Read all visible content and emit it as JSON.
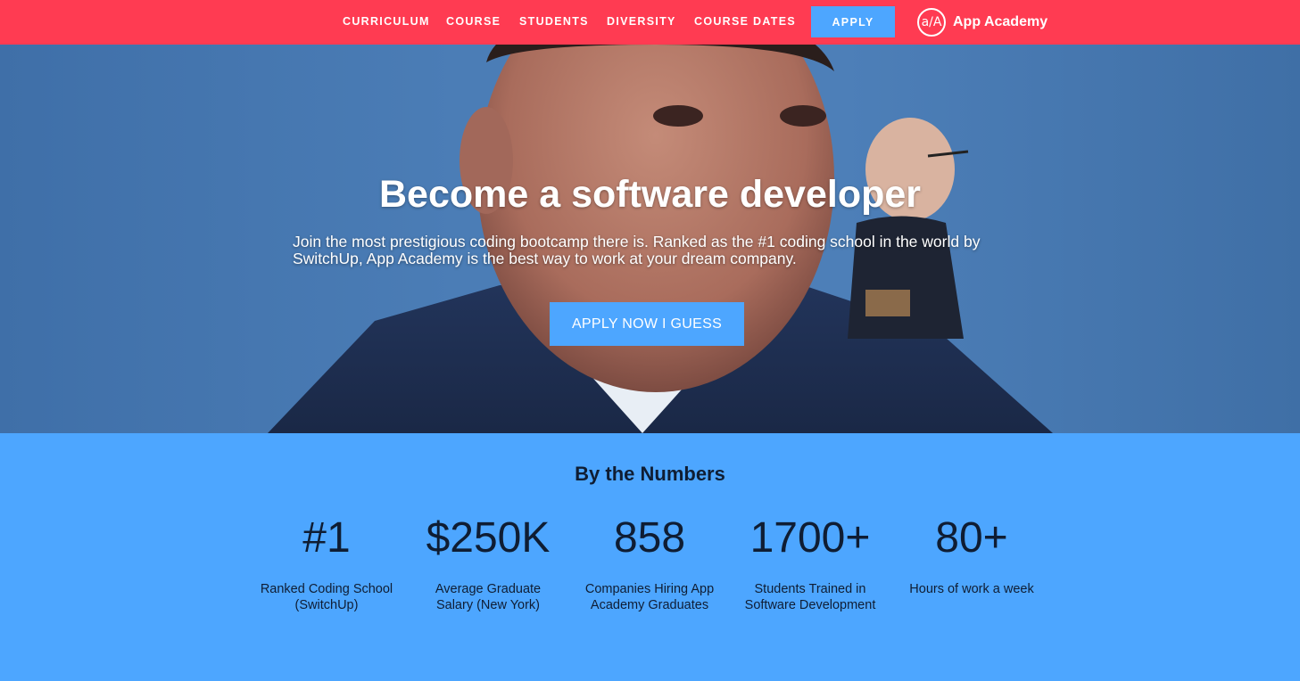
{
  "nav": {
    "links": [
      "CURRICULUM",
      "COURSE",
      "STUDENTS",
      "DIVERSITY",
      "COURSE DATES"
    ],
    "apply_label": "APPLY",
    "logo_mark": "a/A",
    "logo_text": "App Academy"
  },
  "hero": {
    "title": "Become a software developer",
    "subtitle": "Join the most prestigious coding bootcamp there is. Ranked as the #1 coding school in the world by SwitchUp, App Academy is the best way to work at your dream company.",
    "cta_label": "APPLY NOW I GUESS"
  },
  "numbers": {
    "title": "By the Numbers",
    "stats": [
      {
        "value": "#1",
        "label": "Ranked Coding School (SwitchUp)"
      },
      {
        "value": "$250K",
        "label": "Average Graduate Salary (New York)"
      },
      {
        "value": "858",
        "label": "Companies Hiring App Academy Graduates"
      },
      {
        "value": "1700+",
        "label": "Students Trained in Software Development"
      },
      {
        "value": "80+",
        "label": "Hours of work a week"
      }
    ]
  },
  "colors": {
    "navbar": "#ff3b52",
    "accent_blue": "#4da6ff",
    "text_dark": "#0f1d33"
  }
}
